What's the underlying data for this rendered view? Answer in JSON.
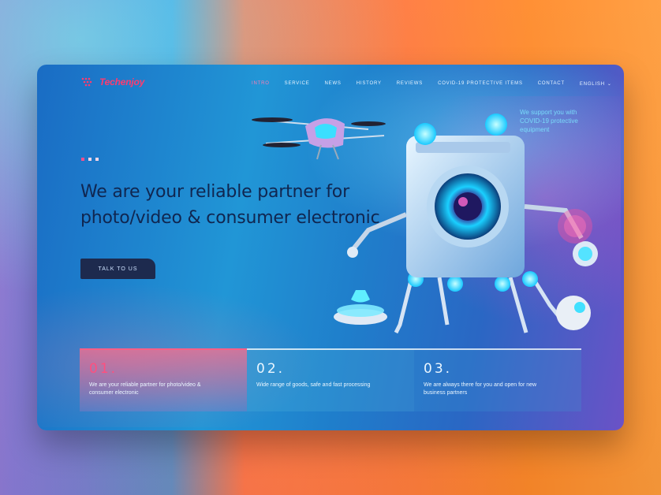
{
  "brand": {
    "name": "Techenjoy",
    "accent": "#ff3b6f"
  },
  "nav": {
    "items": [
      {
        "label": "INTRO",
        "active": true
      },
      {
        "label": "SERVICE"
      },
      {
        "label": "NEWS"
      },
      {
        "label": "HISTORY"
      },
      {
        "label": "REVIEWS"
      },
      {
        "label": "COVID-19 PROTECTIVE ITEMS"
      },
      {
        "label": "CONTACT"
      },
      {
        "label": "ENGLISH",
        "dropdown": true
      }
    ]
  },
  "hero": {
    "title": "We are your reliable partner for photo/video & consumer electronic",
    "cta": "TALK TO US",
    "slides": 3,
    "callout": "We support you with COVID-19 protective equipment"
  },
  "cards": [
    {
      "num": "01.",
      "text": "We are your reliable partner for photo/video & consumer electronic"
    },
    {
      "num": "02.",
      "text": "Wide range of goods, safe and fast processing"
    },
    {
      "num": "03.",
      "text": "We are always there for you and open for new business partners"
    }
  ],
  "icons": [
    "logo-mark-icon",
    "chevron-down-icon",
    "drone-icon",
    "robot-washing-machine-illustration",
    "virus-hologram-icon"
  ]
}
